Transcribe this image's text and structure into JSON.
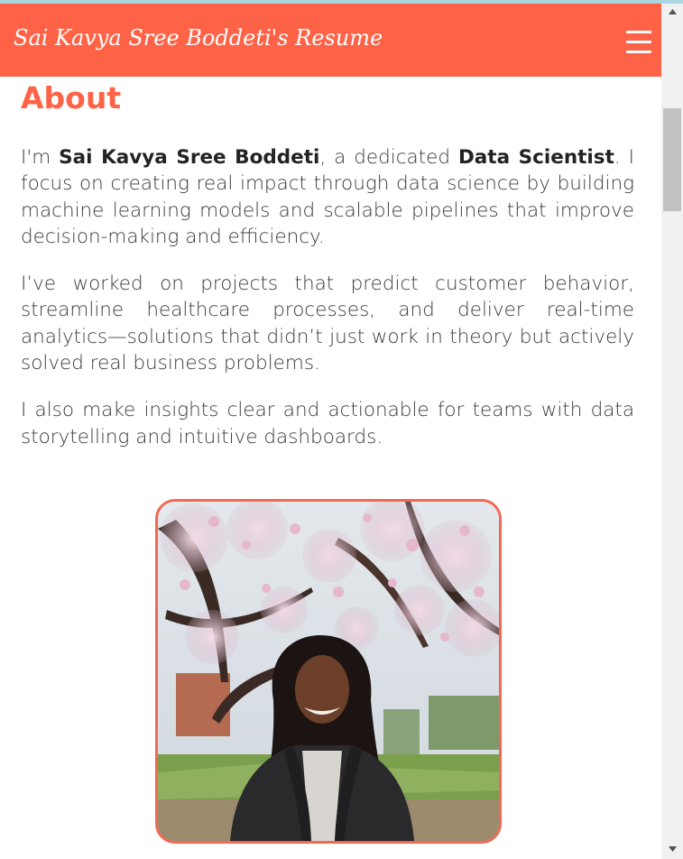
{
  "header": {
    "brand": "Sai Kavya Sree Boddeti's Resume",
    "menu_icon": "hamburger-menu-icon"
  },
  "about": {
    "title": "About",
    "p1": {
      "t1": "I'm ",
      "name": "Sai Kavya Sree Boddeti",
      "t2": ", a dedicated ",
      "role": "Data Scientist",
      "t3": ". I focus on creating real impact through data science by building machine learning models and scalable pipelines that improve decision-making and efficiency."
    },
    "p2": "I’ve worked on projects that predict customer behavior, streamline healthcare processes, and deliver real-time analytics—solutions that didn’t just work in theory but actively solved real business problems.",
    "p3": "I also make insights clear and actionable for teams with data storytelling and intuitive dashboards."
  },
  "photo": {
    "subject": "profile-photo",
    "border_color": "#f06a52"
  },
  "colors": {
    "accent": "#ff6347",
    "text": "#3a3a3a"
  }
}
